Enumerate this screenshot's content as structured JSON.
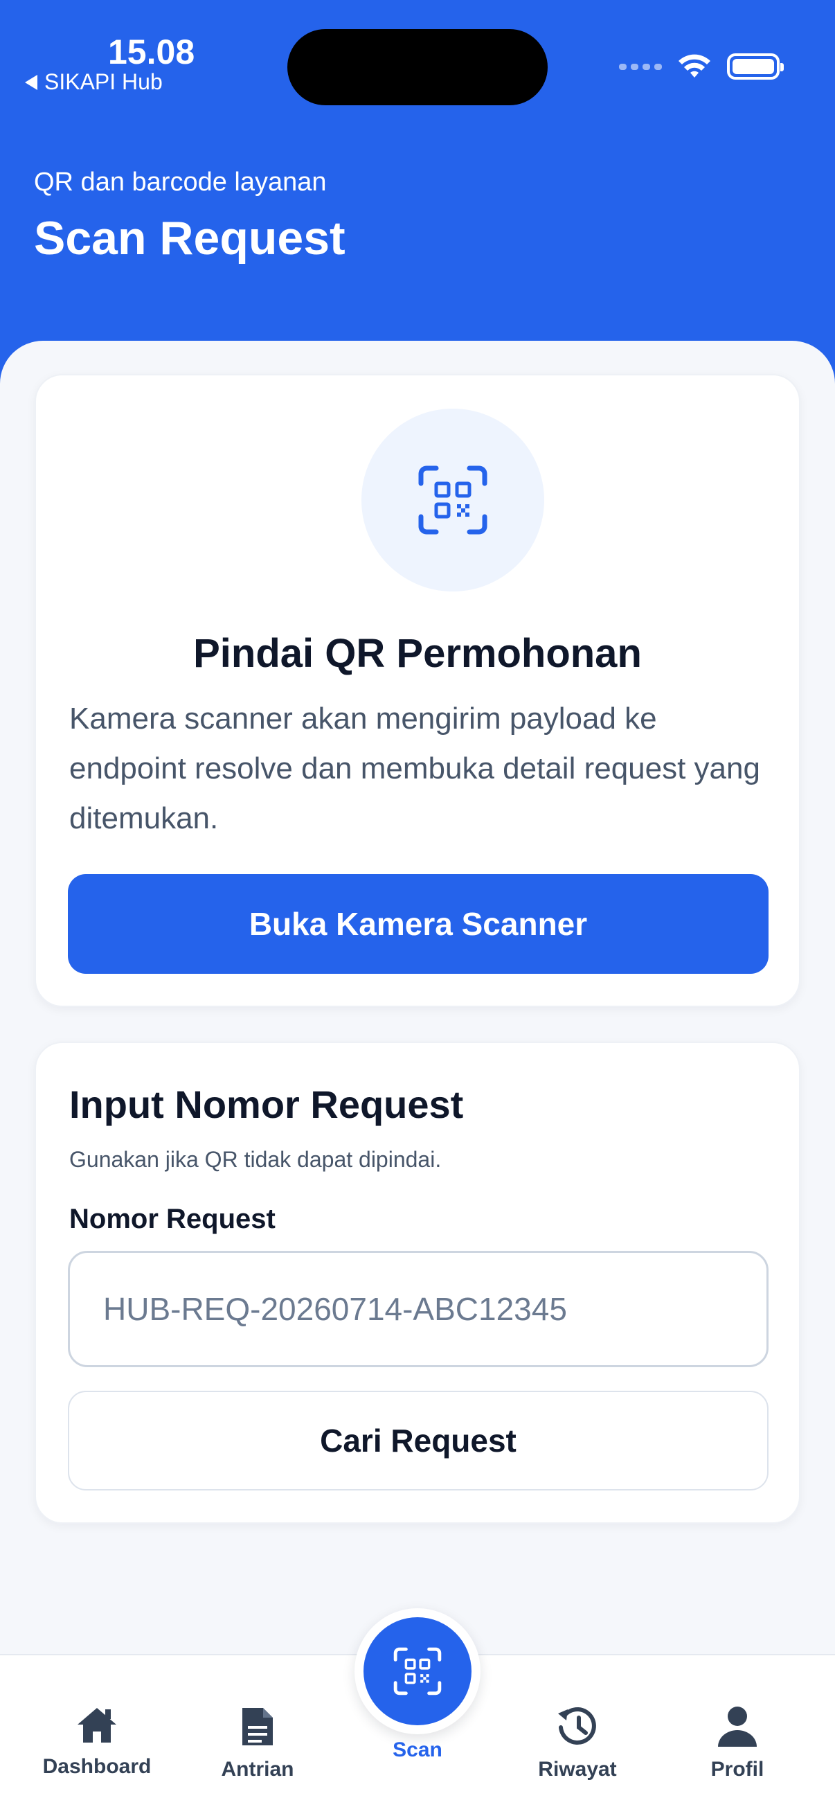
{
  "status_bar": {
    "time": "15.08",
    "back_app": "SIKAPI Hub"
  },
  "header": {
    "subtitle": "QR dan barcode layanan",
    "title": "Scan Request"
  },
  "scan_card": {
    "icon": "qr-code-scan-icon",
    "title": "Pindai QR Permohonan",
    "description": "Kamera scanner akan mengirim payload ke endpoint resolve dan membuka detail request yang ditemukan.",
    "button_label": "Buka Kamera Scanner"
  },
  "manual_card": {
    "title": "Input Nomor Request",
    "description": "Gunakan jika QR tidak dapat dipindai.",
    "field_label": "Nomor Request",
    "field_value": "",
    "field_placeholder": "HUB-REQ-20260714-ABC12345",
    "button_label": "Cari Request"
  },
  "bottom_nav": {
    "items": [
      {
        "label": "Dashboard",
        "icon": "home-icon"
      },
      {
        "label": "Antrian",
        "icon": "document-icon"
      },
      {
        "label": "Scan",
        "icon": "qr-code-scan-icon",
        "active": true
      },
      {
        "label": "Riwayat",
        "icon": "history-icon"
      },
      {
        "label": "Profil",
        "icon": "user-icon"
      }
    ]
  },
  "colors": {
    "primary": "#2563eb",
    "text_dark": "#0f172a",
    "text_muted": "#475569",
    "background": "#f5f7fb"
  }
}
